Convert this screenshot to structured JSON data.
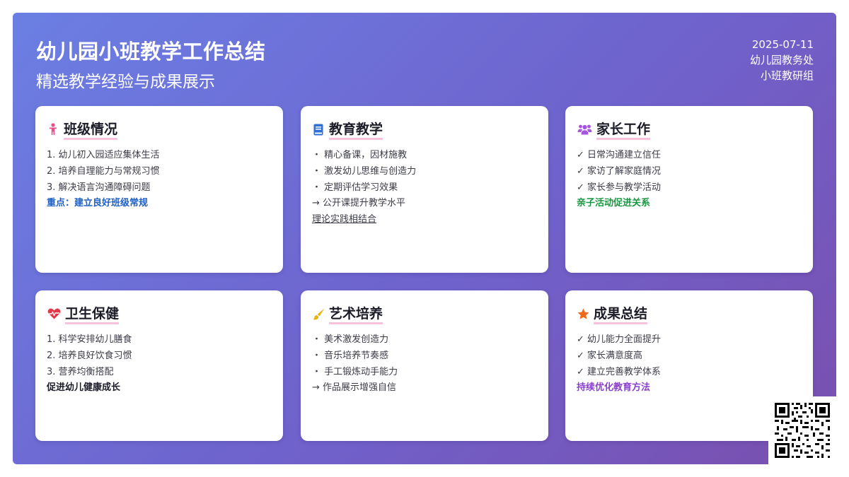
{
  "header": {
    "title": "幼儿园小班教学工作总结",
    "subtitle": "精选教学经验与成果展示"
  },
  "meta": {
    "date": "2025-07-11",
    "org": "幼儿园教务处",
    "group": "小班教研组"
  },
  "colors": {
    "gradient_start": "#6b7fe3",
    "gradient_end": "#7a4fae",
    "title_underline": "#f7c3dc",
    "accent_blue": "#1f5fc2",
    "accent_green": "#1a9641",
    "accent_purple": "#8b3fd1"
  },
  "cards": [
    {
      "title": "班级情况",
      "icon": "child-icon",
      "lines": [
        "1. 幼儿初入园适应集体生活",
        "2. 培养自理能力与常规习惯",
        "3. 解决语言沟通障碍问题"
      ],
      "highlight": "重点：建立良好班级常规"
    },
    {
      "title": "教育教学",
      "icon": "book-icon",
      "lines": [
        "・ 精心备课，因材施教",
        "・ 激发幼儿思维与创造力",
        "・ 定期评估学习效果",
        "→ 公开课提升教学水平"
      ],
      "highlight": "理论实践相结合"
    },
    {
      "title": "家长工作",
      "icon": "users-icon",
      "lines": [
        "✓ 日常沟通建立信任",
        "✓ 家访了解家庭情况",
        "✓ 家长参与教学活动"
      ],
      "highlight": "亲子活动促进关系"
    },
    {
      "title": "卫生保健",
      "icon": "heart-pulse-icon",
      "lines": [
        "1. 科学安排幼儿膳食",
        "2. 培养良好饮食习惯",
        "3. 营养均衡搭配"
      ],
      "highlight": "促进幼儿健康成长"
    },
    {
      "title": "艺术培养",
      "icon": "paintbrush-icon",
      "lines": [
        "・ 美术激发创造力",
        "・ 音乐培养节奏感",
        "・ 手工锻炼动手能力",
        "→ 作品展示增强自信"
      ],
      "highlight": ""
    },
    {
      "title": "成果总结",
      "icon": "star-icon",
      "lines": [
        "✓ 幼儿能力全面提升",
        "✓ 家长满意度高",
        "✓ 建立完善教学体系"
      ],
      "highlight": "持续优化教育方法"
    }
  ],
  "qr": {
    "icon": "qr-code-icon"
  }
}
